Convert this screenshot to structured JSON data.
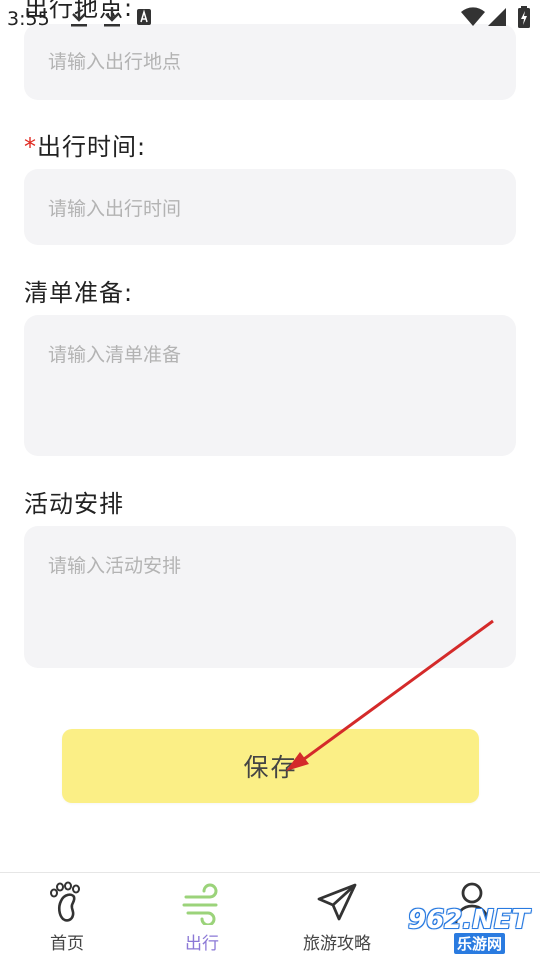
{
  "status_bar": {
    "time": "3:55",
    "icons": [
      "download-icon",
      "download-icon",
      "a-notification-icon",
      "wifi-icon",
      "signal-icon",
      "battery-charging-icon"
    ]
  },
  "form": {
    "place": {
      "label": "出行地点:",
      "placeholder": "请输入出行地点"
    },
    "time": {
      "required_mark": "*",
      "label": "出行时间:",
      "placeholder": "请输入出行时间"
    },
    "list": {
      "label": "清单准备:",
      "placeholder": "请输入清单准备"
    },
    "activity": {
      "label": "活动安排",
      "placeholder": "请输入活动安排"
    }
  },
  "save_button": {
    "label": "保存"
  },
  "bottom_nav": {
    "items": [
      {
        "label": "首页",
        "icon": "footprint-icon",
        "active": false
      },
      {
        "label": "出行",
        "icon": "wind-icon",
        "active": true
      },
      {
        "label": "旅游攻略",
        "icon": "paper-plane-icon",
        "active": false
      },
      {
        "label": "",
        "icon": "user-icon",
        "active": false
      }
    ]
  },
  "watermark": {
    "main": "962.NET",
    "sub": "乐游网"
  },
  "colors": {
    "save_button_bg": "#fbef86",
    "input_bg": "#f4f4f6",
    "active_nav": "#8b78d6",
    "required_star": "#e0281f",
    "annotation_arrow": "#d42a2a"
  }
}
